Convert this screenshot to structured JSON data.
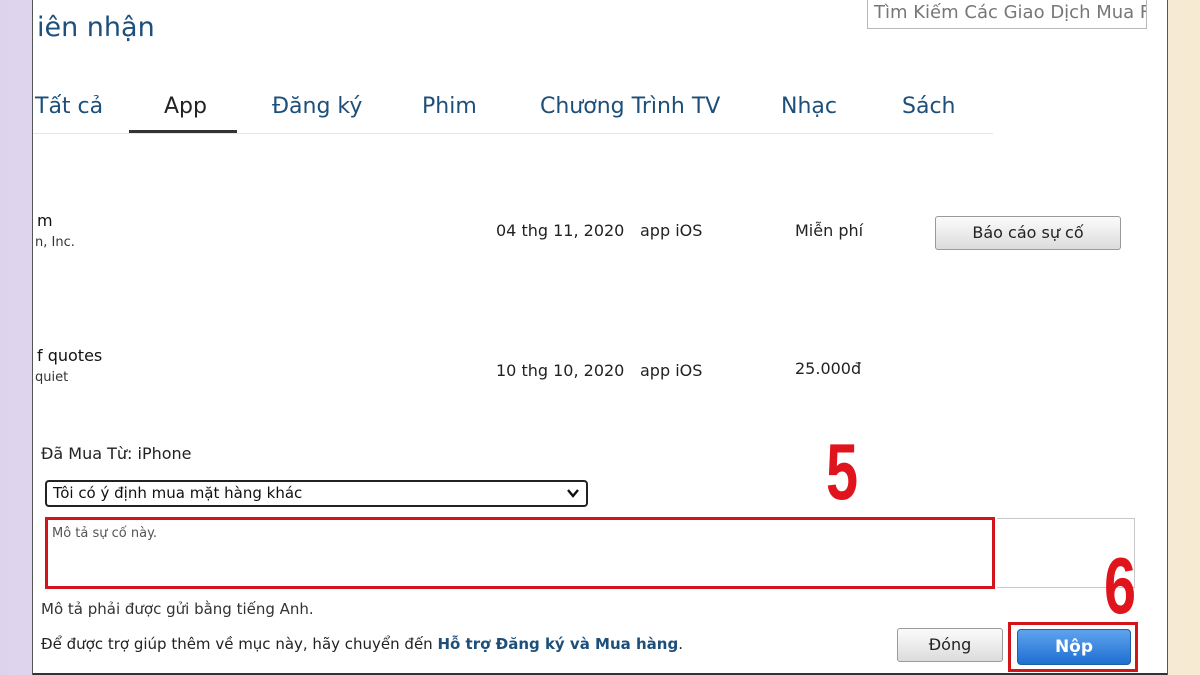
{
  "header": {
    "title": "iên nhận",
    "search_placeholder": "Tìm Kiếm Các Giao Dịch Mua F"
  },
  "tabs": [
    {
      "label": "Tất cả",
      "active": false
    },
    {
      "label": "App",
      "active": true
    },
    {
      "label": "Đăng ký",
      "active": false
    },
    {
      "label": "Phim",
      "active": false
    },
    {
      "label": "Chương Trình TV",
      "active": false
    },
    {
      "label": "Nhạc",
      "active": false
    },
    {
      "label": "Sách",
      "active": false
    }
  ],
  "purchases": [
    {
      "name": "m",
      "developer": "n, Inc.",
      "date": "04 thg 11, 2020",
      "type": "app iOS",
      "price": "Miễn phí",
      "action": "Báo cáo sự cố"
    },
    {
      "name": "f quotes",
      "developer": "quiet",
      "date": "10 thg 10, 2020",
      "type": "app iOS",
      "price": "25.000đ"
    }
  ],
  "report_form": {
    "purchased_from": "Đã Mua Từ: iPhone",
    "reason_selected": "Tôi có ý định mua mặt hàng khác",
    "description_placeholder": "Mô tả sự cố này.",
    "english_note": "Mô tả phải được gửi bằng tiếng Anh.",
    "help_text": "Để được trợ giúp thêm về mục này, hãy chuyển đến ",
    "help_link": "Hỗ trợ Đăng ký và Mua hàng",
    "help_suffix": ".",
    "close_label": "Đóng",
    "submit_label": "Nộp"
  },
  "annotations": {
    "step_5": "5",
    "step_6": "6"
  },
  "colors": {
    "highlight": "#d3141a",
    "link": "#1d4f7a",
    "submit": "#1f6fd0"
  }
}
